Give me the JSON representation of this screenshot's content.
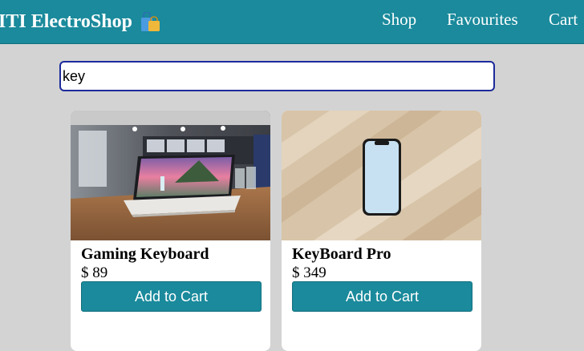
{
  "brand": {
    "title": "ITI ElectroShop",
    "icon": "shopping-bags-icon"
  },
  "nav": {
    "items": [
      {
        "label": "Shop"
      },
      {
        "label": "Favourites"
      },
      {
        "label": "Cart"
      }
    ]
  },
  "search": {
    "value": "key"
  },
  "products": [
    {
      "name": "Gaming Keyboard",
      "price": "$ 89",
      "button": "Add to Cart",
      "image": "laptop-on-table-image"
    },
    {
      "name": "KeyBoard Pro",
      "price": "$ 349",
      "button": "Add to Cart",
      "image": "phone-on-wood-image"
    }
  ],
  "colors": {
    "accent": "#1a8a9c",
    "background": "#d3d3d3",
    "search_border": "#1d2a9b"
  }
}
